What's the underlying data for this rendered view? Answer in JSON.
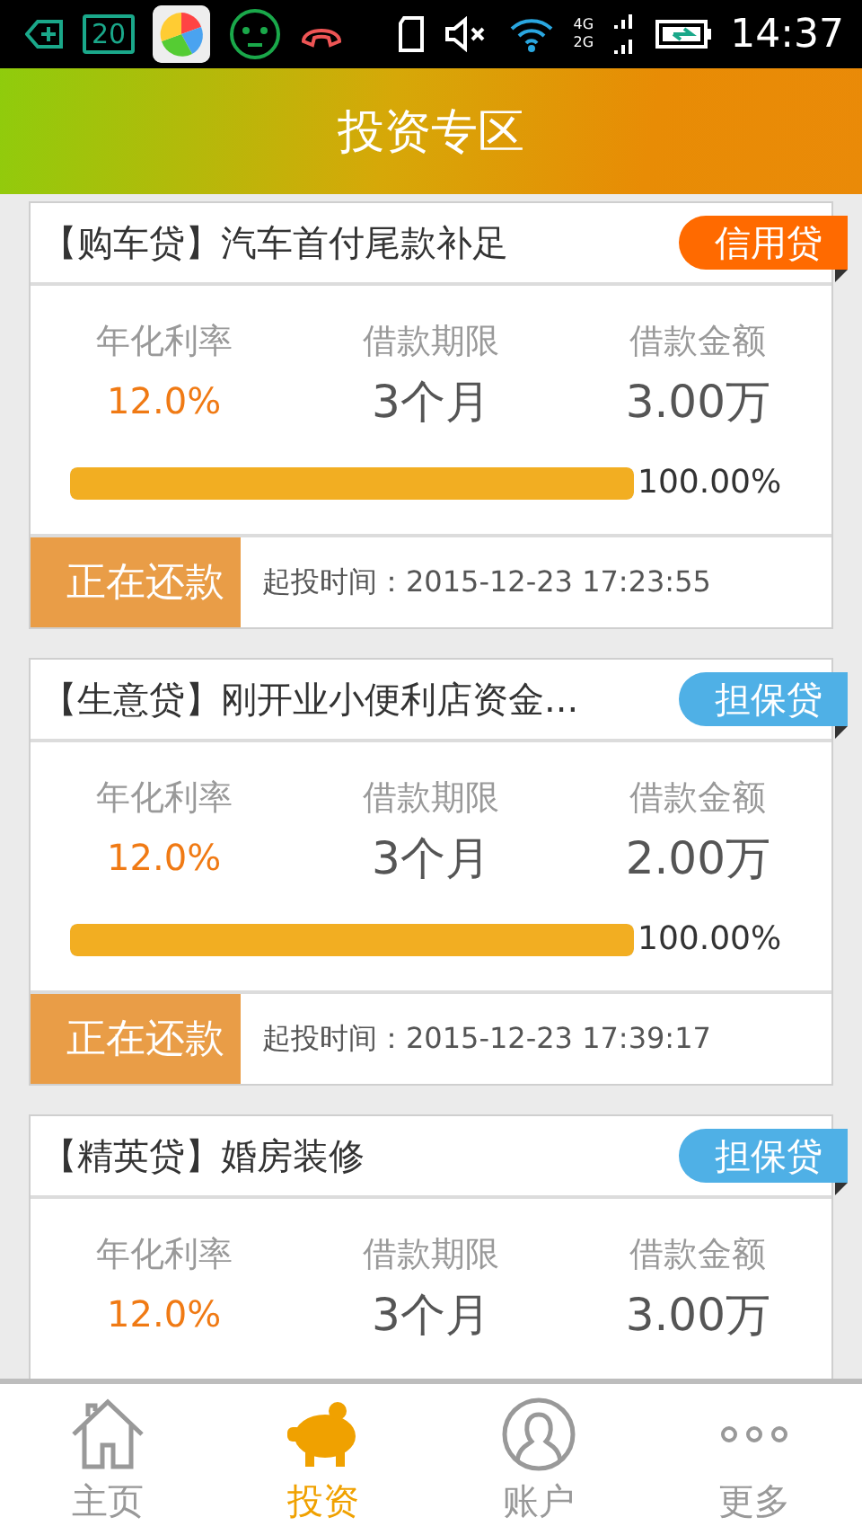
{
  "status_bar": {
    "notification_badge": "20",
    "network_labels": [
      "4G",
      "2G"
    ],
    "time": "14:37"
  },
  "header": {
    "title": "投资专区"
  },
  "loans": [
    {
      "title": "【购车贷】汽车首付尾款补足",
      "tag": "信用贷",
      "color": "#ff6a00",
      "stats": [
        {
          "label": "年化利率",
          "value": "12.0%",
          "kind": "rate"
        },
        {
          "label": "借款期限",
          "value": "3个月",
          "kind": "plain"
        },
        {
          "label": "借款金额",
          "value": "3.00万",
          "kind": "plain"
        }
      ],
      "level": 1,
      "percent": "100.00%",
      "status": "正在还款",
      "start_time": "起投时间：2015-12-23 17:23:55"
    },
    {
      "title": "【生意贷】刚开业小便利店资金...",
      "tag": "担保贷",
      "color": "#4fb0e6",
      "stats": [
        {
          "label": "年化利率",
          "value": "12.0%",
          "kind": "rate"
        },
        {
          "label": "借款期限",
          "value": "3个月",
          "kind": "plain"
        },
        {
          "label": "借款金额",
          "value": "2.00万",
          "kind": "plain"
        }
      ],
      "level": 1,
      "percent": "100.00%",
      "status": "正在还款",
      "start_time": "起投时间：2015-12-23 17:39:17"
    },
    {
      "title": "【精英贷】婚房装修",
      "tag": "担保贷",
      "color": "#4fb0e6",
      "stats": [
        {
          "label": "年化利率",
          "value": "12.0%",
          "kind": "rate"
        },
        {
          "label": "借款期限",
          "value": "3个月",
          "kind": "plain"
        },
        {
          "label": "借款金额",
          "value": "3.00万",
          "kind": "plain"
        }
      ]
    }
  ],
  "tabs": [
    {
      "label": "主页",
      "kind": "home",
      "selected": false
    },
    {
      "label": "投资",
      "kind": "invest",
      "selected": true
    },
    {
      "label": "账户",
      "kind": "account",
      "selected": false
    },
    {
      "label": "更多",
      "kind": "more",
      "selected": false
    }
  ]
}
